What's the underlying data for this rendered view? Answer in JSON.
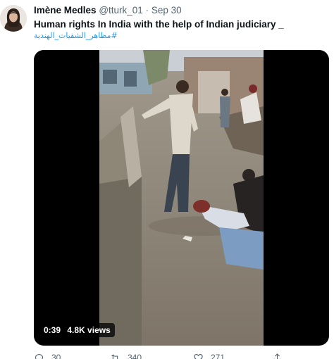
{
  "author": {
    "name": "Imène Medles",
    "handle": "@tturk_01",
    "separator": "·",
    "date": "Sep 30"
  },
  "tweet": {
    "text": "Human rights In India with the help of Indian judiciary _",
    "hashtag": "#مظاهر_الشقيات_الهندية"
  },
  "video": {
    "duration": "0:39",
    "views": "4.8K views"
  },
  "actions": {
    "replies": "30",
    "retweets": "340",
    "likes": "271"
  },
  "icons": {
    "reply": "reply-icon",
    "retweet": "retweet-icon",
    "like": "heart-icon",
    "share": "share-icon"
  },
  "colors": {
    "accent": "#1d9bf0",
    "secondary_text": "#536471",
    "media_background": "#000000"
  }
}
